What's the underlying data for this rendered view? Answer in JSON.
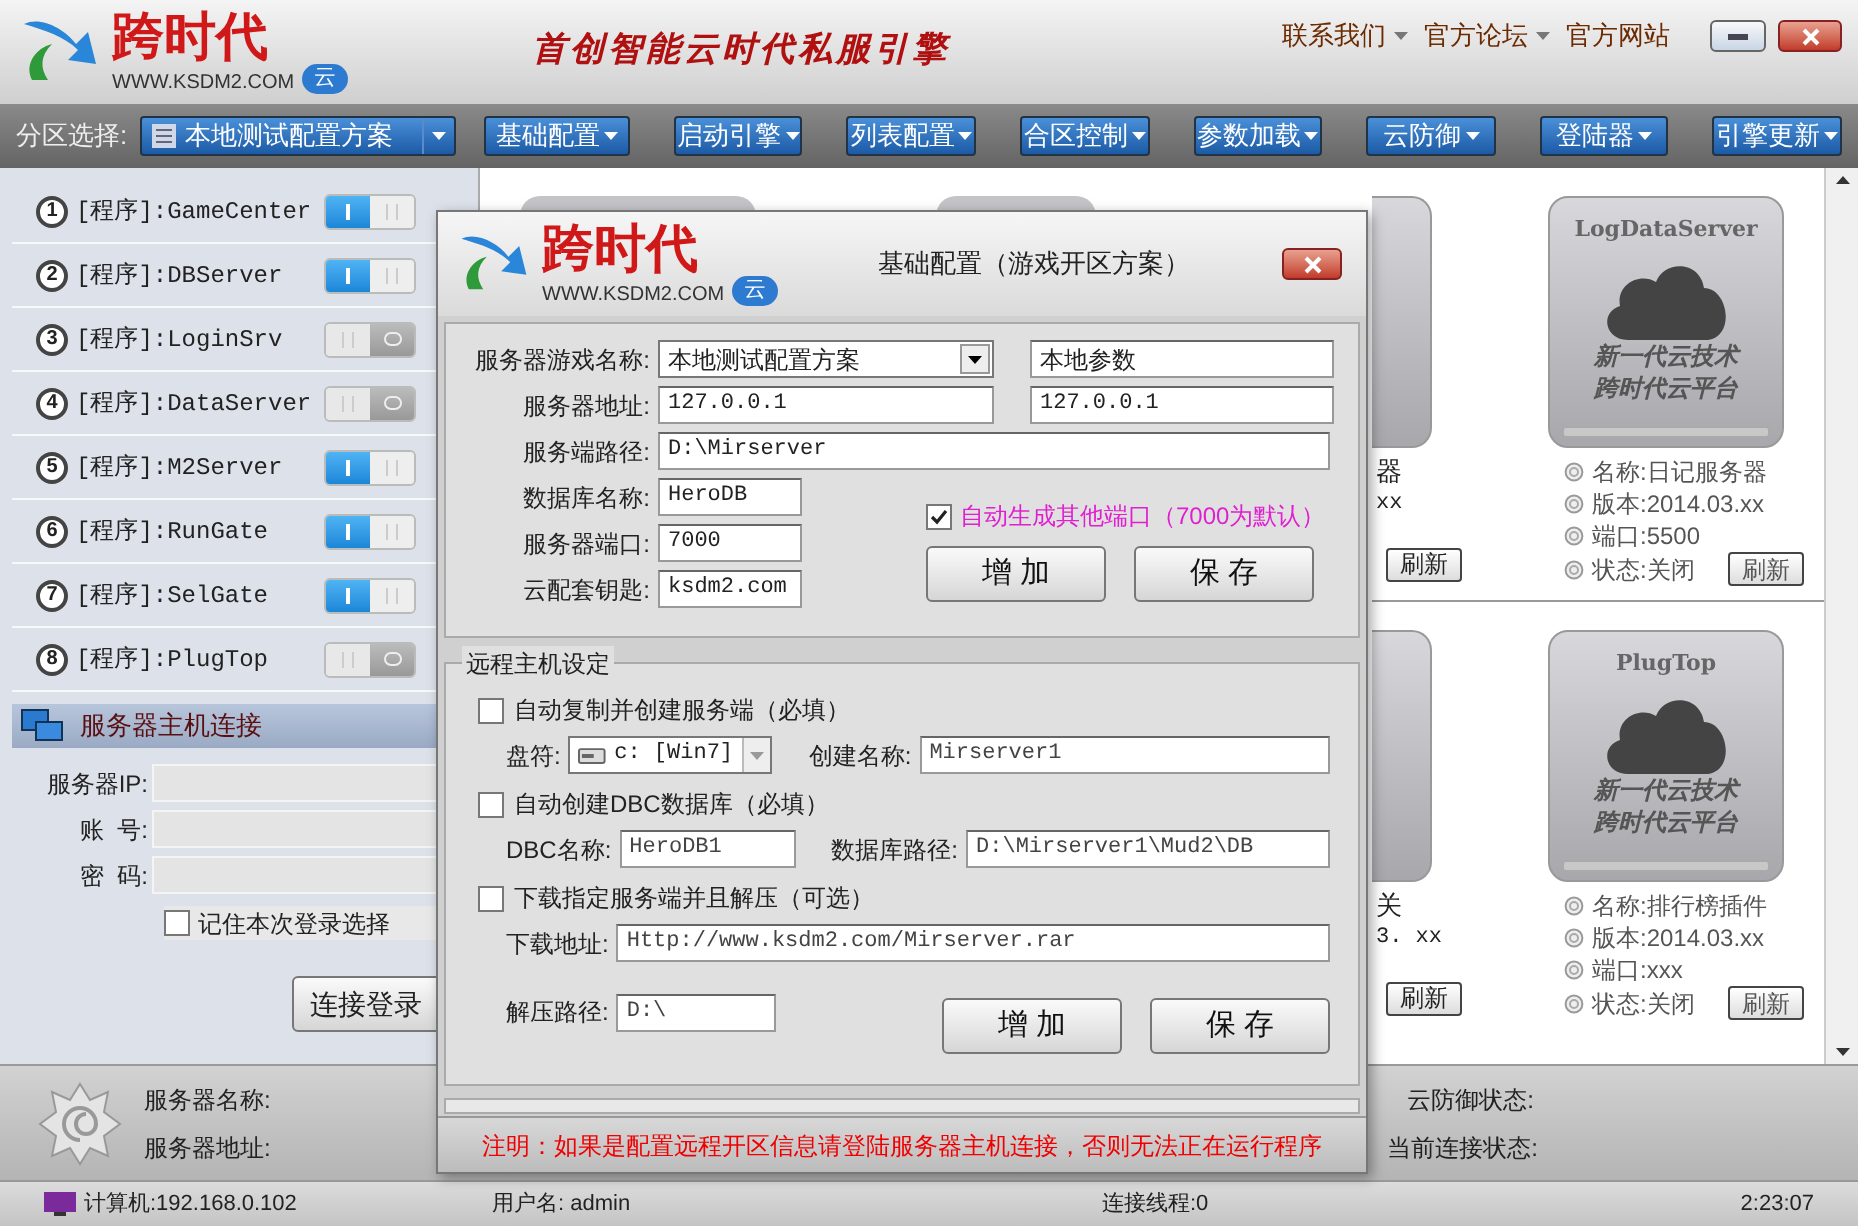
{
  "header": {
    "logo": {
      "name": "跨时代",
      "url": "WWW.KSDM2.COM",
      "badge": "云"
    },
    "slogan": "首创智能云时代私服引擎",
    "links": [
      {
        "label": "联系我们",
        "dropdown": true
      },
      {
        "label": "官方论坛",
        "dropdown": true
      },
      {
        "label": "官方网站",
        "dropdown": false
      }
    ]
  },
  "toolbar": {
    "zone_label": "分区选择:",
    "zone_value": "本地测试配置方案",
    "menus": [
      "基础配置",
      "启动引擎",
      "列表配置",
      "合区控制",
      "参数加载",
      "云防御",
      "登陆器",
      "引擎更新"
    ]
  },
  "programs": [
    {
      "number": "1",
      "label": "[程序]:GameCenter",
      "on": true
    },
    {
      "number": "2",
      "label": "[程序]:DBServer",
      "on": true
    },
    {
      "number": "3",
      "label": "[程序]:LoginSrv",
      "on": false
    },
    {
      "number": "4",
      "label": "[程序]:DataServer",
      "on": false
    },
    {
      "number": "5",
      "label": "[程序]:M2Server",
      "on": true
    },
    {
      "number": "6",
      "label": "[程序]:RunGate",
      "on": true
    },
    {
      "number": "7",
      "label": "[程序]:SelGate",
      "on": true
    },
    {
      "number": "8",
      "label": "[程序]:PlugTop",
      "on": false
    }
  ],
  "host_connection": {
    "title": "服务器主机连接",
    "fields": [
      {
        "label": "服务器IP:"
      },
      {
        "label": "账  号:"
      },
      {
        "label": "密  码:"
      }
    ],
    "remember": {
      "label": "记住本次登录选择",
      "checked": false
    },
    "button": "连接登录"
  },
  "cards": {
    "partial": [
      {
        "lines": [
          "器",
          "xx"
        ],
        "button": "刷新"
      },
      {
        "lines": [
          "关",
          "3. xx"
        ],
        "button": "刷新"
      }
    ],
    "full": [
      {
        "title": "LogDataServer",
        "tagline": [
          "新一代云技术",
          "跨时代云平台"
        ],
        "lines": [
          "名称:日记服务器",
          "版本:2014.03.xx",
          "端口:5500",
          "状态:关闭"
        ],
        "button": "刷新"
      },
      {
        "title": "PlugTop",
        "tagline": [
          "新一代云技术",
          "跨时代云平台"
        ],
        "lines": [
          "名称:排行榜插件",
          "版本:2014.03.xx",
          "端口:xxx",
          "状态:关闭"
        ],
        "button": "刷新"
      }
    ]
  },
  "server_info": {
    "left": [
      "服务器名称:",
      "服务器地址:"
    ],
    "right": [
      "云防御状态:",
      "当前连接状态:"
    ]
  },
  "status_bar": {
    "computer": "计算机:192.168.0.102",
    "user": "用户名: admin",
    "threads": "连接线程:0",
    "time": "2:23:07"
  },
  "dialog": {
    "logo": {
      "name": "跨时代",
      "url": "WWW.KSDM2.COM",
      "badge": "云"
    },
    "title": "基础配置（游戏开区方案）",
    "game_name": {
      "label": "服务器游戏名称:",
      "value": "本地测试配置方案",
      "extra": "本地参数"
    },
    "address": {
      "label": "服务器地址:",
      "value": "127.0.0.1",
      "extra": "127.0.0.1"
    },
    "path": {
      "label": "服务端路径:",
      "value": "D:\\Mirserver"
    },
    "small_fields": [
      {
        "label": "数据库名称:",
        "value": "HeroDB"
      },
      {
        "label": "服务器端口:",
        "value": "7000"
      },
      {
        "label": "云配套钥匙:",
        "value": "ksdm2.com"
      }
    ],
    "auto_ports": {
      "label": "自动生成其他端口（7000为默认）",
      "checked": true
    },
    "buttons": [
      "增 加",
      "保 存"
    ],
    "remote": {
      "title": "远程主机设定",
      "sections": [
        {
          "label": "自动复制并创建服务端（必填）",
          "checked": false,
          "fields": [
            {
              "kind": "drive",
              "label": "盘符:",
              "value": "c: [Win7]"
            },
            {
              "kind": "text",
              "label": "创建名称:",
              "value": "Mirserver1"
            }
          ]
        },
        {
          "label": "自动创建DBC数据库（必填）",
          "checked": false,
          "fields": [
            {
              "kind": "text",
              "label": "DBC名称:",
              "value": "HeroDB1"
            },
            {
              "kind": "text",
              "label": "数据库路径:",
              "value": "D:\\Mirserver1\\Mud2\\DB"
            }
          ]
        },
        {
          "label": "下载指定服务端并且解压（可选）",
          "checked": false,
          "fields": [
            {
              "kind": "wide",
              "label": "下载地址:",
              "value": "Http://www.ksdm2.com/Mirserver.rar"
            },
            {
              "kind": "short",
              "label": "解压路径:",
              "value": "D:\\"
            }
          ]
        }
      ],
      "buttons": [
        "增 加",
        "保 存"
      ]
    },
    "note": "注明：如果是配置远程开区信息请登陆服务器主机连接，否则无法正在运行程序"
  }
}
